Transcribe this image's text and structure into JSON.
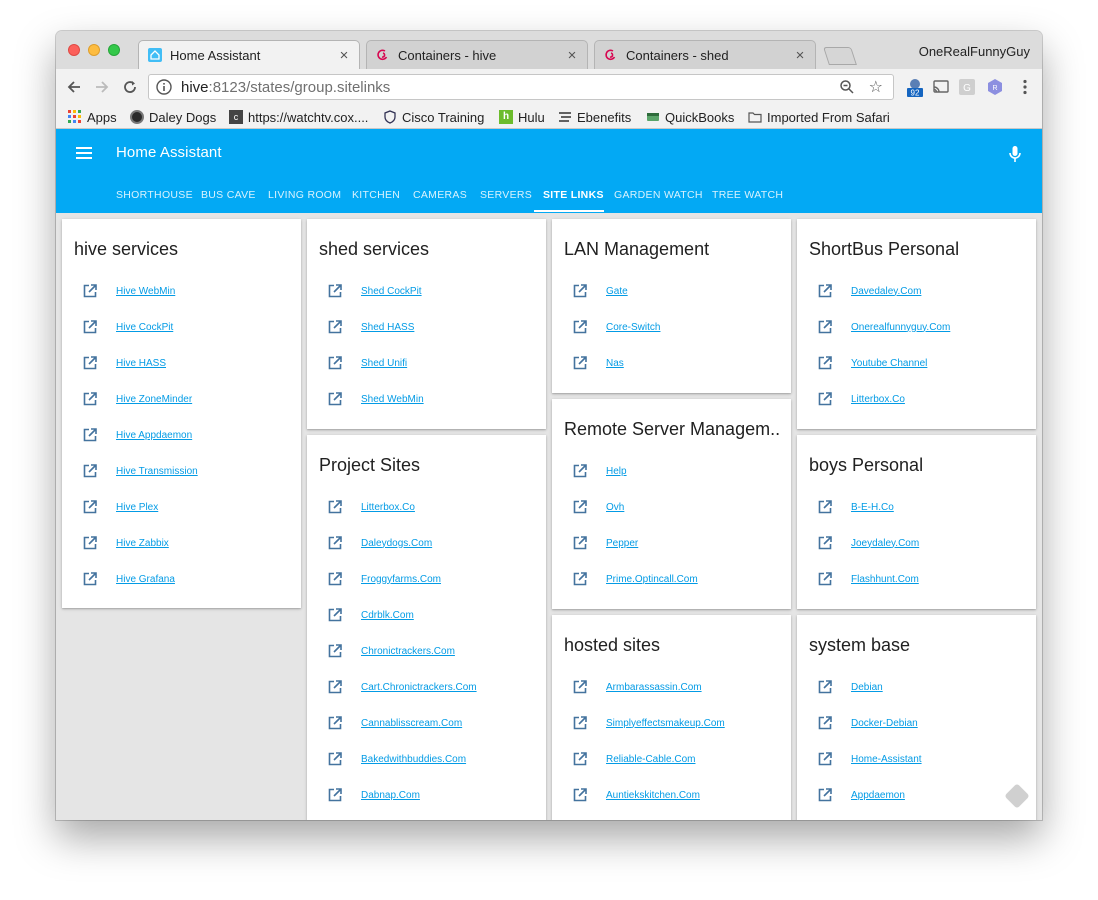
{
  "browser": {
    "profile": "OneRealFunnyGuy",
    "tabs": [
      {
        "label": "Home Assistant",
        "close": "×"
      },
      {
        "label": "Containers - hive",
        "close": "×"
      },
      {
        "label": "Containers - shed",
        "close": "×"
      }
    ],
    "url_host": "hive",
    "url_rest": ":8123/states/group.sitelinks",
    "ext_badge": "92",
    "bookmarks": [
      "Apps",
      "Daley Dogs",
      "https://watchtv.cox....",
      "Cisco Training",
      "Hulu",
      "Ebenefits",
      "QuickBooks",
      "Imported From Safari"
    ]
  },
  "app": {
    "title": "Home Assistant",
    "tabs": [
      "SHORTHOUSE",
      "BUS CAVE",
      "LIVING ROOM",
      "KITCHEN",
      "CAMERAS",
      "SERVERS",
      "SITE LINKS",
      "GARDEN WATCH",
      "TREE WATCH"
    ],
    "selected_tab": "SITE LINKS",
    "accent": "#03a9f4",
    "link_color": "#039be5"
  },
  "cards": {
    "hive": {
      "title": "hive services",
      "links": [
        "Hive WebMin",
        "Hive CockPit",
        "Hive HASS",
        "Hive ZoneMinder",
        "Hive Appdaemon",
        "Hive Transmission",
        "Hive Plex",
        "Hive Zabbix",
        "Hive Grafana"
      ]
    },
    "shed": {
      "title": "shed services",
      "links": [
        "Shed CockPit",
        "Shed HASS",
        "Shed Unifi",
        "Shed WebMin"
      ]
    },
    "project": {
      "title": "Project Sites",
      "links": [
        "Litterbox.Co",
        "Daleydogs.Com",
        "Froggyfarms.Com",
        "Cdrblk.Com",
        "Chronictrackers.Com",
        "Cart.Chronictrackers.Com",
        "Cannablisscream.Com",
        "Bakedwithbuddies.Com",
        "Dabnap.Com"
      ]
    },
    "lan": {
      "title": "LAN Management",
      "links": [
        "Gate",
        "Core-Switch",
        "Nas"
      ]
    },
    "remote": {
      "title": "Remote Server Managem...",
      "links": [
        "Help",
        "Ovh",
        "Pepper",
        "Prime.Optincall.Com"
      ]
    },
    "hosted": {
      "title": "hosted sites",
      "links": [
        "Armbarassassin.Com",
        "Simplyeffectsmakeup.Com",
        "Reliable-Cable.Com",
        "Auntiekskitchen.Com"
      ]
    },
    "shortbus": {
      "title": "ShortBus Personal",
      "links": [
        "Davedaley.Com",
        "Onerealfunnyguy.Com",
        "Youtube Channel",
        "Litterbox.Co"
      ]
    },
    "boys": {
      "title": "boys Personal",
      "links": [
        "B-E-H.Co",
        "Joeydaley.Com",
        "Flashhunt.Com"
      ]
    },
    "system": {
      "title": "system base",
      "links": [
        "Debian",
        "Docker-Debian",
        "Home-Assistant",
        "Appdaemon"
      ]
    }
  }
}
